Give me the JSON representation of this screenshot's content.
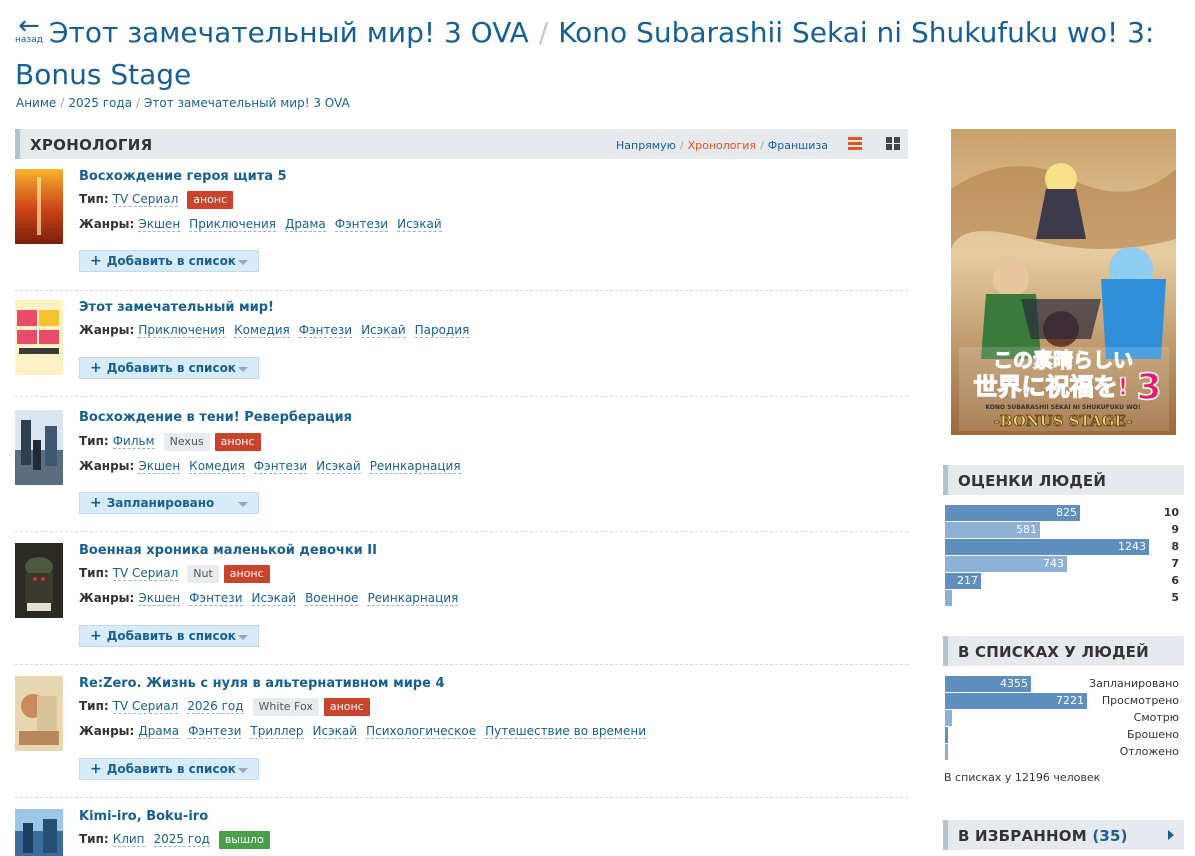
{
  "nav": {
    "back_arrow": "←",
    "back_label": "назад"
  },
  "title": {
    "ru": "Этот замечательный мир! 3 OVA",
    "sep": "/",
    "en": "Kono Subarashii Sekai ni Shukufuku wo! 3: Bonus Stage"
  },
  "breadcrumbs": [
    "Аниме",
    "2025 года",
    "Этот замечательный мир! 3 OVA"
  ],
  "chronology": {
    "heading": "ХРОНОЛОГИЯ",
    "views": [
      "Напрямую",
      "Хронология",
      "Франшиза"
    ],
    "active_view": "Хронология"
  },
  "labels": {
    "type": "Тип:",
    "genres": "Жанры:"
  },
  "entries": [
    {
      "title": "Восхождение героя щита 5",
      "type": "TV Сериал",
      "tags": [
        {
          "text": "анонс",
          "kind": "anons"
        }
      ],
      "genres": [
        "Экшен",
        "Приключения",
        "Драма",
        "Фэнтези",
        "Исэкай"
      ],
      "button": "Добавить в список"
    },
    {
      "title": "Этот замечательный мир!",
      "genres": [
        "Приключения",
        "Комедия",
        "Фэнтези",
        "Исэкай",
        "Пародия"
      ],
      "button": "Добавить в список"
    },
    {
      "title": "Восхождение в тени! Реверберация",
      "type": "Фильм",
      "tags": [
        {
          "text": "Nexus",
          "kind": "studio"
        },
        {
          "text": "анонс",
          "kind": "anons"
        }
      ],
      "genres": [
        "Экшен",
        "Комедия",
        "Фэнтези",
        "Исэкай",
        "Реинкарнация"
      ],
      "button": "Запланировано"
    },
    {
      "title": "Военная хроника маленькой девочки II",
      "type": "TV Сериал",
      "tags": [
        {
          "text": "Nut",
          "kind": "studio"
        },
        {
          "text": "анонс",
          "kind": "anons"
        }
      ],
      "genres": [
        "Экшен",
        "Фэнтези",
        "Исэкай",
        "Военное",
        "Реинкарнация"
      ],
      "button": "Добавить в список"
    },
    {
      "title": "Re:Zero. Жизнь с нуля в альтернативном мире 4",
      "type": "TV Сериал",
      "year": "2026 год",
      "tags": [
        {
          "text": "White Fox",
          "kind": "studio"
        },
        {
          "text": "анонс",
          "kind": "anons"
        }
      ],
      "genres": [
        "Драма",
        "Фэнтези",
        "Триллер",
        "Исэкай",
        "Психологическое",
        "Путешествие во времени"
      ],
      "button": "Добавить в список"
    },
    {
      "title": "Kimi-iro, Boku-iro",
      "type": "Клип",
      "year": "2025 год",
      "tags": [
        {
          "text": "вышло",
          "kind": "out"
        }
      ]
    }
  ],
  "poster": {
    "logo_jp_line1": "この素晴らしい",
    "logo_jp_line2": "世界に祝福を!",
    "logo_num": "3",
    "logo_romaji": "KONO SUBARASHII SEKAI NI SHUKUFUKU WO!",
    "logo_bonus": "-BONUS STAGE-"
  },
  "scores": {
    "heading": "ОЦЕНКИ ЛЮДЕЙ",
    "items": [
      {
        "score": "10",
        "count": 825
      },
      {
        "score": "9",
        "count": 581
      },
      {
        "score": "8",
        "count": 1243
      },
      {
        "score": "7",
        "count": 743
      },
      {
        "score": "6",
        "count": 217
      },
      {
        "score": "5",
        "count": 41
      }
    ]
  },
  "lists": {
    "heading": "В СПИСКАХ У ЛЮДЕЙ",
    "items": [
      {
        "label": "Запланировано",
        "count": 4355
      },
      {
        "label": "Просмотрено",
        "count": 7221
      },
      {
        "label": "Смотрю",
        "count": 345
      },
      {
        "label": "Брошено",
        "count": 100
      },
      {
        "label": "Отложено",
        "count": 175
      }
    ],
    "total": "В списках у 12196 человек"
  },
  "favorites": {
    "heading": "В ИЗБРАННОМ",
    "count": "(35)"
  },
  "colors": {
    "link": "#176093",
    "anons": "#c8442c",
    "out": "#4aa04a",
    "bar": "#5f8fbf",
    "active": "#e2541f"
  }
}
